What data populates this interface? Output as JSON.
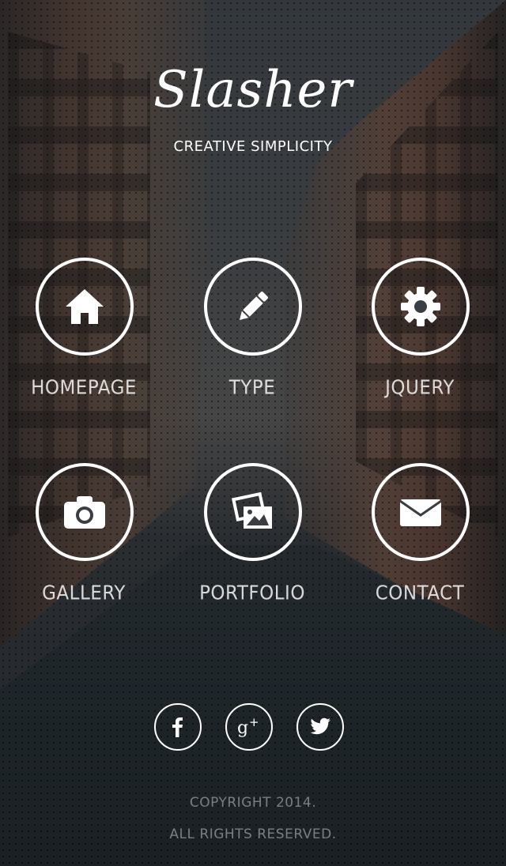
{
  "brand": {
    "logo": "Slasher",
    "tagline": "CREATIVE SIMPLICITY"
  },
  "nav": {
    "items": [
      {
        "label": "HOMEPAGE",
        "icon": "home-icon"
      },
      {
        "label": "TYPE",
        "icon": "pencil-icon"
      },
      {
        "label": "JQUERY",
        "icon": "gear-icon"
      },
      {
        "label": "GALLERY",
        "icon": "camera-icon"
      },
      {
        "label": "PORTFOLIO",
        "icon": "pictures-icon"
      },
      {
        "label": "CONTACT",
        "icon": "envelope-icon"
      }
    ]
  },
  "social": {
    "items": [
      {
        "icon": "facebook-icon"
      },
      {
        "icon": "google-plus-icon"
      },
      {
        "icon": "twitter-icon"
      }
    ]
  },
  "footer": {
    "line1": "COPYRIGHT 2014.",
    "line2": "ALL RIGHTS RESERVED."
  }
}
